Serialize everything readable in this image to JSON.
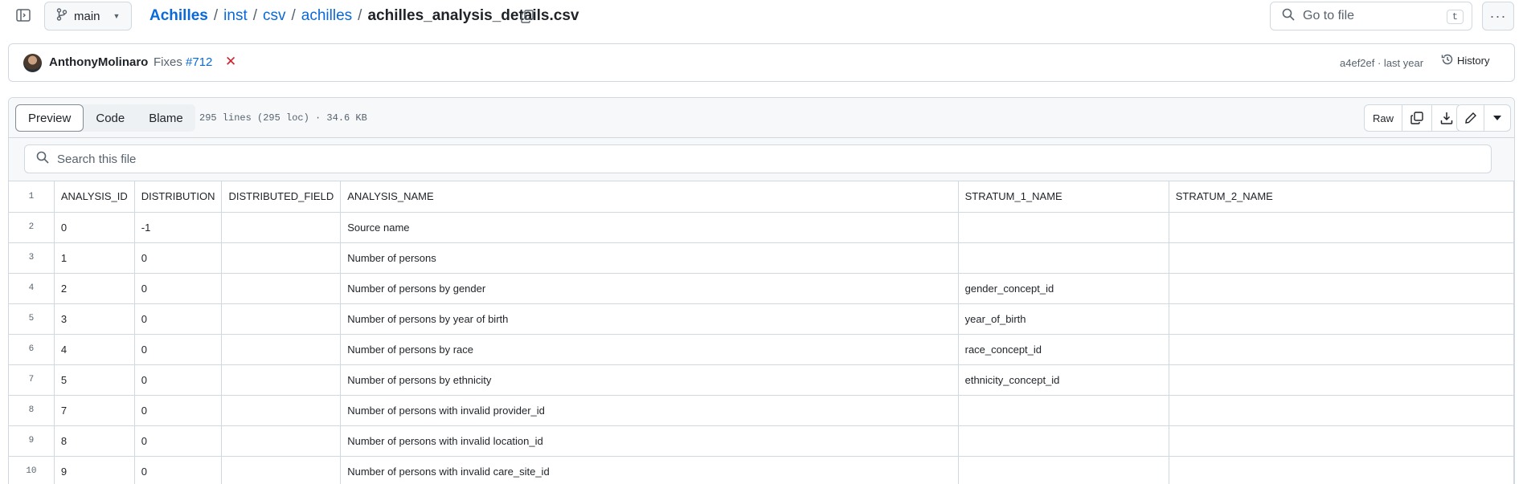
{
  "topbar": {
    "branch": "main",
    "breadcrumb": [
      {
        "label": "Achilles",
        "kind": "repo"
      },
      {
        "label": "inst",
        "kind": "dir"
      },
      {
        "label": "csv",
        "kind": "dir"
      },
      {
        "label": "achilles",
        "kind": "dir"
      }
    ],
    "separator": "/",
    "current_file": "achilles_analysis_details.csv",
    "goto_placeholder": "Go to file",
    "goto_shortcut": "t",
    "more_label": "···"
  },
  "commit": {
    "author": "AnthonyMolinaro",
    "message_prefix": "Fixes",
    "issue_link": "#712",
    "status_icon": "x-icon",
    "status_color": "#cf222e",
    "sha_time": "a4ef2ef · last year",
    "history_label": "History"
  },
  "file_header": {
    "tabs": [
      "Preview",
      "Code",
      "Blame"
    ],
    "active_tab": "Preview",
    "info": "295 lines (295 loc) · 34.6 KB",
    "raw_label": "Raw"
  },
  "search": {
    "placeholder": "Search this file"
  },
  "table": {
    "headers": [
      "ANALYSIS_ID",
      "DISTRIBUTION",
      "DISTRIBUTED_FIELD",
      "ANALYSIS_NAME",
      "STRATUM_1_NAME",
      "STRATUM_2_NAME"
    ],
    "header_line": "1",
    "rows": [
      {
        "line": "2",
        "cells": [
          "0",
          "-1",
          "",
          "Source name",
          "",
          ""
        ]
      },
      {
        "line": "3",
        "cells": [
          "1",
          "0",
          "",
          "Number of persons",
          "",
          ""
        ]
      },
      {
        "line": "4",
        "cells": [
          "2",
          "0",
          "",
          "Number of persons by gender",
          "gender_concept_id",
          ""
        ]
      },
      {
        "line": "5",
        "cells": [
          "3",
          "0",
          "",
          "Number of persons by year of birth",
          "year_of_birth",
          ""
        ]
      },
      {
        "line": "6",
        "cells": [
          "4",
          "0",
          "",
          "Number of persons by race",
          "race_concept_id",
          ""
        ]
      },
      {
        "line": "7",
        "cells": [
          "5",
          "0",
          "",
          "Number of persons by ethnicity",
          "ethnicity_concept_id",
          ""
        ]
      },
      {
        "line": "8",
        "cells": [
          "7",
          "0",
          "",
          "Number of persons with invalid provider_id",
          "",
          ""
        ]
      },
      {
        "line": "9",
        "cells": [
          "8",
          "0",
          "",
          "Number of persons with invalid location_id",
          "",
          ""
        ]
      },
      {
        "line": "10",
        "cells": [
          "9",
          "0",
          "",
          "Number of persons with invalid care_site_id",
          "",
          ""
        ]
      }
    ]
  }
}
